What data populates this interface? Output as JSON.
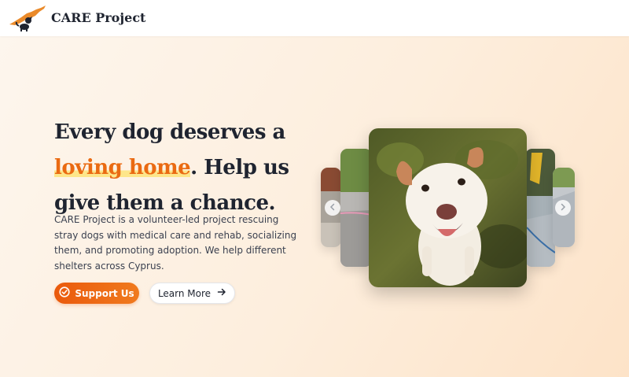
{
  "nav": {
    "brand": "CARE Project",
    "logo_icon": "cyprus-map-dog-logo"
  },
  "hero": {
    "title_part1": "Every dog deserves a ",
    "title_accent": "loving home",
    "title_part2": ". Help us give them a chance.",
    "description": "CARE Project is a volunteer-led project rescuing stray dogs with medical care and rehab, socializing them, and promoting adoption. We help different shelters across Cyprus.",
    "primary_button": {
      "label": "Support Us",
      "icon": "check-circle-icon"
    },
    "secondary_button": {
      "label": "Learn More",
      "icon": "arrow-right-icon"
    }
  },
  "carousel": {
    "prev_icon": "chevron-left-icon",
    "next_icon": "chevron-right-icon"
  },
  "colors": {
    "accent": "#ea6a12",
    "highlight": "#fde68a",
    "text": "#1f2430"
  }
}
